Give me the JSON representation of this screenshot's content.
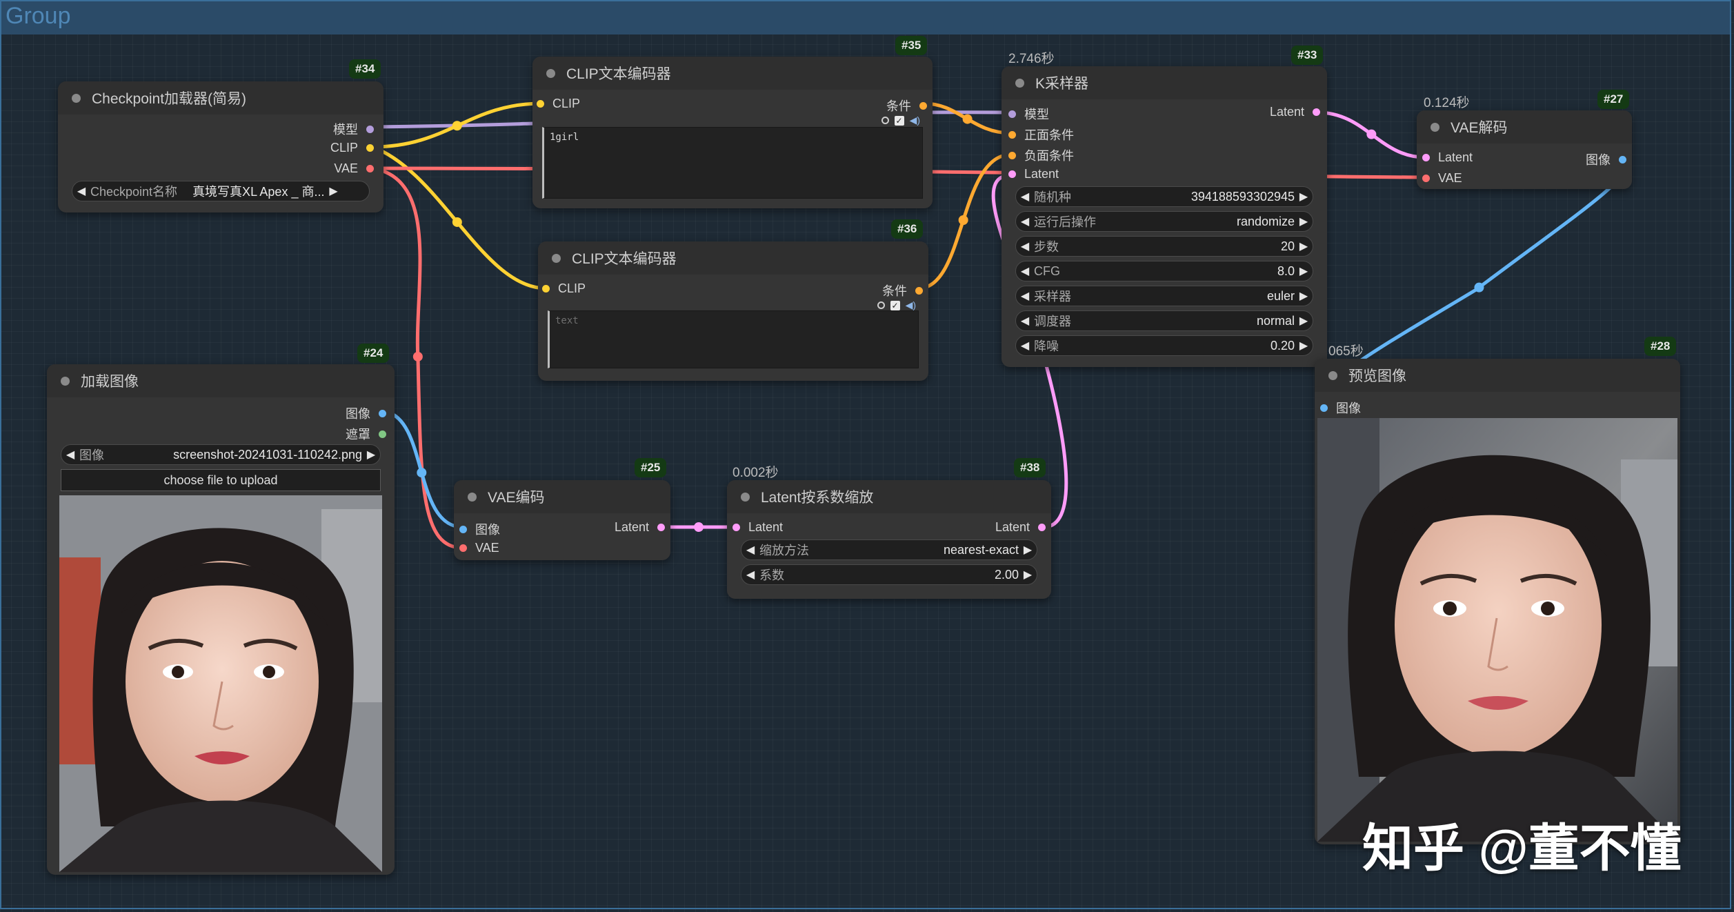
{
  "group": {
    "title": "Group"
  },
  "colors": {
    "model": "#b39ddb",
    "clip": "#ffd233",
    "vae": "#ff6e6e",
    "conditioning": "#ffa931",
    "latent": "#ff9cf9",
    "image": "#64b5f6",
    "mask": "#81c784"
  },
  "nodes": {
    "checkpoint": {
      "id": "#34",
      "title": "Checkpoint加载器(简易)",
      "outputs": [
        "模型",
        "CLIP",
        "VAE"
      ],
      "widget": {
        "label": "Checkpoint名称",
        "value": "真境写真XL Apex _ 商..."
      }
    },
    "clip_pos": {
      "id": "#35",
      "title": "CLIP文本编码器",
      "input": "CLIP",
      "output": "条件",
      "text": "1girl"
    },
    "clip_neg": {
      "id": "#36",
      "title": "CLIP文本编码器",
      "input": "CLIP",
      "output": "条件",
      "placeholder": "text"
    },
    "ksampler": {
      "id": "#33",
      "title": "K采样器",
      "timing": "2.746秒",
      "inputs": [
        "模型",
        "正面条件",
        "负面条件",
        "Latent"
      ],
      "output": "Latent",
      "widgets": [
        {
          "label": "随机种",
          "value": "394188593302945"
        },
        {
          "label": "运行后操作",
          "value": "randomize"
        },
        {
          "label": "步数",
          "value": "20"
        },
        {
          "label": "CFG",
          "value": "8.0"
        },
        {
          "label": "采样器",
          "value": "euler"
        },
        {
          "label": "调度器",
          "value": "normal"
        },
        {
          "label": "降噪",
          "value": "0.20"
        }
      ]
    },
    "vae_decode": {
      "id": "#27",
      "title": "VAE解码",
      "timing": "0.124秒",
      "inputs": [
        "Latent",
        "VAE"
      ],
      "output": "图像"
    },
    "preview": {
      "id": "#28",
      "title": "预览图像",
      "timing": "065秒",
      "input": "图像"
    },
    "load_image": {
      "id": "#24",
      "title": "加载图像",
      "outputs": [
        "图像",
        "遮罩"
      ],
      "widget": {
        "label": "图像",
        "value": "screenshot-20241031-110242.png"
      },
      "upload_label": "choose file to upload"
    },
    "vae_encode": {
      "id": "#25",
      "title": "VAE编码",
      "inputs": [
        "图像",
        "VAE"
      ],
      "output": "Latent"
    },
    "latent_scale": {
      "id": "#38",
      "title": "Latent按系数缩放",
      "timing": "0.002秒",
      "input": "Latent",
      "output": "Latent",
      "widgets": [
        {
          "label": "缩放方法",
          "value": "nearest-exact"
        },
        {
          "label": "系数",
          "value": "2.00"
        }
      ]
    }
  },
  "watermark": "知乎 @董不懂"
}
